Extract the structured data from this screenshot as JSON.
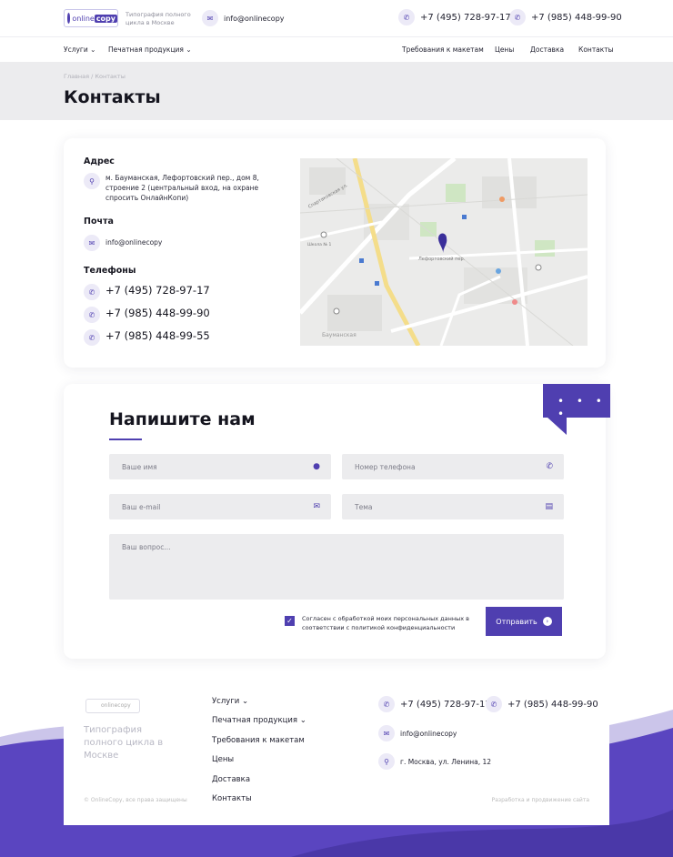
{
  "header": {
    "logo_word1": "online",
    "logo_word2": "copy",
    "tagline": "Типография полного цикла в Москве",
    "email": "info@onlinecopy",
    "phone1": "+7 (495) 728-97-17",
    "phone2": "+7 (985) 448-99-90"
  },
  "nav": {
    "services": "Услуги",
    "print": "Печатная продукция",
    "requirements": "Требования к макетам",
    "prices": "Цены",
    "delivery": "Доставка",
    "contacts": "Контакты"
  },
  "hero": {
    "breadcrumb": "Главная / Контакты",
    "title": "Контакты"
  },
  "contacts": {
    "address_title": "Адрес",
    "address": "м. Бауманская, Лефортовский пер., дом 8, строение 2 (центральный вход, на охране спросить ОнлайнКопи)",
    "mail_title": "Почта",
    "mail": "info@onlinecopy",
    "phones_title": "Телефоны",
    "phones": [
      "+7 (495) 728-97-17",
      "+7 (985) 448-99-90",
      "+7 (985) 448-99-55"
    ]
  },
  "map": {
    "street1": "Спартаковская ул.",
    "street2": "Лефортовский пер.",
    "street3": "Бауманская",
    "poi1": "Школа № 1",
    "poi2": "Бауманская"
  },
  "form": {
    "title": "Напишите нам",
    "name_placeholder": "Ваше имя",
    "phone_placeholder": "Номер телефона",
    "email_placeholder": "Ваш e-mail",
    "subject_placeholder": "Тема",
    "message_placeholder": "Ваш вопрос...",
    "consent": "Согласен с обработкой моих персональных данных в соответствии с политикой конфиденциальности",
    "submit": "Отправить",
    "corner_dots": "• • • •"
  },
  "footer": {
    "logo": "onlinecopy",
    "slogan": "Типография полного цикла в Москве",
    "copyright": "© OnlineCopy, все права защищены",
    "nav": [
      "Услуги",
      "Печатная продукция",
      "Требования к макетам",
      "Цены",
      "Доставка",
      "Контакты"
    ],
    "phone1": "+7 (495) 728-97-17",
    "phone2": "+7 (985) 448-99-90",
    "email": "info@onlinecopy",
    "address": "г. Москва, ул. Ленина, 12",
    "developer": "Разработка и продвижение сайта"
  },
  "colors": {
    "accent": "#4f3fb0",
    "hero_bg": "#ececee",
    "wave": "#5a45c0"
  }
}
